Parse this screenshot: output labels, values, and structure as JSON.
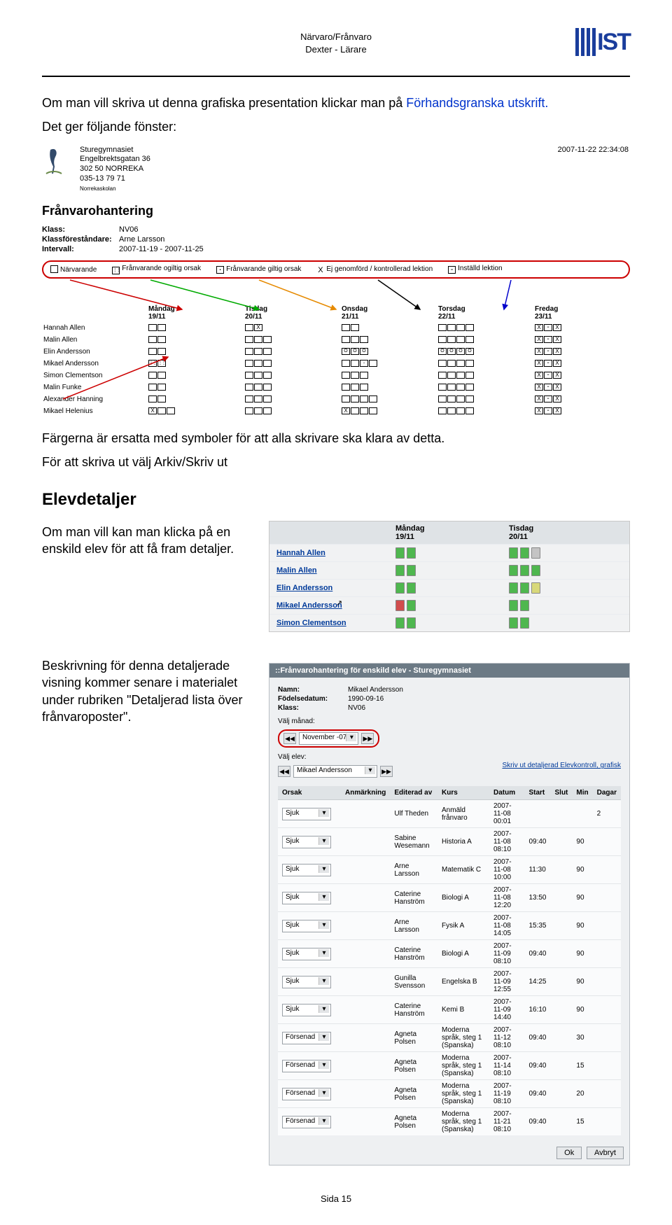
{
  "header": {
    "line1": "Närvaro/Frånvaro",
    "line2": "Dexter - Lärare",
    "logo_text": "IST"
  },
  "intro": {
    "p1a": "Om man vill skriva ut denna grafiska presentation klickar man på ",
    "p1_link": "Förhandsgranska utskrift.",
    "p2": "Det ger följande fönster:"
  },
  "ss1": {
    "school": [
      "Sturegymnasiet",
      "Engelbrektsgatan 36",
      "302 50 NORREKA",
      "",
      "035-13 79 71"
    ],
    "skolan": "Norrekaskolan",
    "timestamp": "2007-11-22 22:34:08",
    "title": "Frånvarohantering",
    "kv": [
      {
        "k": "Klass:",
        "v": "NV06"
      },
      {
        "k": "Klassföreståndare:",
        "v": "Arne Larsson"
      },
      {
        "k": "Intervall:",
        "v": "2007-11-19 - 2007-11-25"
      }
    ],
    "legend": [
      "Närvarande",
      "Frånvarande ogiltig orsak",
      "Frånvarande giltig orsak",
      "Ej genomförd / kontrollerad lektion",
      "Inställd lektion"
    ],
    "days": [
      {
        "d": "Måndag",
        "dd": "19/11"
      },
      {
        "d": "Tisdag",
        "dd": "20/11"
      },
      {
        "d": "Onsdag",
        "dd": "21/11"
      },
      {
        "d": "Torsdag",
        "dd": "22/11"
      },
      {
        "d": "Fredag",
        "dd": "23/11"
      }
    ],
    "rows": [
      {
        "n": "Hannah Allen",
        "c": [
          [
            "",
            ""
          ],
          [
            "",
            "x"
          ],
          [
            "",
            ""
          ],
          [
            "",
            "",
            "",
            ""
          ],
          [
            "x",
            "m",
            "x"
          ]
        ]
      },
      {
        "n": "Malin Allen",
        "c": [
          [
            "",
            ""
          ],
          [
            "",
            "",
            ""
          ],
          [
            "",
            "",
            ""
          ],
          [
            "",
            "",
            "",
            ""
          ],
          [
            "x",
            "m",
            "x"
          ]
        ]
      },
      {
        "n": "Elin Andersson",
        "c": [
          [
            "",
            ""
          ],
          [
            "",
            "",
            ""
          ],
          [
            "o",
            "o",
            "o"
          ],
          [
            "o",
            "o",
            "o",
            "o"
          ],
          [
            "x",
            "m",
            "x"
          ]
        ]
      },
      {
        "n": "Mikael Andersson",
        "c": [
          [
            "dots",
            "dots"
          ],
          [
            "",
            "",
            ""
          ],
          [
            "",
            "",
            "d",
            ""
          ],
          [
            "",
            "",
            "",
            ""
          ],
          [
            "x",
            "m",
            "x"
          ]
        ]
      },
      {
        "n": "Simon Clementson",
        "c": [
          [
            "",
            ""
          ],
          [
            "",
            "",
            ""
          ],
          [
            "",
            "",
            ""
          ],
          [
            "",
            "",
            "",
            ""
          ],
          [
            "x",
            "m",
            "x"
          ]
        ]
      },
      {
        "n": "Malin Funke",
        "c": [
          [
            "",
            ""
          ],
          [
            "",
            "",
            ""
          ],
          [
            "",
            "",
            ""
          ],
          [
            "",
            "",
            "",
            ""
          ],
          [
            "x",
            "m",
            "x"
          ]
        ]
      },
      {
        "n": "Alexander Hanning",
        "c": [
          [
            "",
            ""
          ],
          [
            "",
            "",
            ""
          ],
          [
            "",
            "",
            "",
            ""
          ],
          [
            "",
            "",
            "",
            ""
          ],
          [
            "x",
            "m",
            "x"
          ]
        ]
      },
      {
        "n": "Mikael Helenius",
        "c": [
          [
            "x",
            "",
            ""
          ],
          [
            "",
            "",
            ""
          ],
          [
            "x",
            "",
            "",
            ""
          ],
          [
            "",
            "",
            "",
            ""
          ],
          [
            "x",
            "m",
            "x"
          ]
        ]
      }
    ]
  },
  "after1": {
    "p1": "Färgerna är ersatta med symboler för att alla skrivare ska klara av detta.",
    "p2": "För att skriva ut välj Arkiv/Skriv ut"
  },
  "elevdetaljer": {
    "title": "Elevdetaljer",
    "p": "Om man vill kan man klicka på en enskild elev för att få fram detaljer."
  },
  "ss2": {
    "days": [
      {
        "d": "Måndag",
        "dd": "19/11"
      },
      {
        "d": "Tisdag",
        "dd": "20/11"
      }
    ],
    "rows": [
      {
        "n": "Hannah Allen",
        "c1": [
          "g",
          "g"
        ],
        "c2": [
          "g",
          "g",
          "gr"
        ]
      },
      {
        "n": "Malin Allen",
        "c1": [
          "g",
          "g"
        ],
        "c2": [
          "g",
          "g",
          "g"
        ]
      },
      {
        "n": "Elin Andersson",
        "c1": [
          "g",
          "g"
        ],
        "c2": [
          "g",
          "g",
          "y"
        ]
      },
      {
        "n": "Mikael Andersson",
        "c1": [
          "r",
          "g"
        ],
        "c2": [
          "g",
          "g"
        ]
      },
      {
        "n": "Simon Clementson",
        "c1": [
          "g",
          "g"
        ],
        "c2": [
          "g",
          "g"
        ]
      }
    ]
  },
  "detail_p": "Beskrivning för denna detaljerade visning kommer senare i materialet under rubriken \"Detaljerad lista över frånvaroposter\".",
  "ss3": {
    "bar": "::Frånvarohantering för enskild elev - Sturegymnasiet",
    "kv": [
      {
        "k": "Namn:",
        "v": "Mikael Andersson"
      },
      {
        "k": "Födelsedatum:",
        "v": "1990-09-16"
      },
      {
        "k": "Klass:",
        "v": "NV06"
      }
    ],
    "sel1_label": "Välj månad:",
    "sel1_value": "November -07",
    "sel2_label": "Välj elev:",
    "sel2_value": "Mikael Andersson",
    "link": "Skriv ut detaljerad Elevkontroll, grafisk",
    "th": [
      "Orsak",
      "Anmärkning",
      "Editerad av",
      "Kurs",
      "Datum",
      "Start",
      "Slut",
      "Min",
      "Dagar"
    ],
    "rows": [
      {
        "o": "Sjuk",
        "a": "",
        "e": "Ulf Theden",
        "k": "Anmäld frånvaro",
        "d": "2007-11-08 00:01",
        "s": "",
        "sl": "",
        "m": "",
        "dg": "2"
      },
      {
        "o": "Sjuk",
        "a": "",
        "e": "Sabine Wesemann",
        "k": "Historia A",
        "d": "2007-11-08 08:10",
        "s": "09:40",
        "sl": "",
        "m": "90",
        "dg": ""
      },
      {
        "o": "Sjuk",
        "a": "",
        "e": "Arne Larsson",
        "k": "Matematik C",
        "d": "2007-11-08 10:00",
        "s": "11:30",
        "sl": "",
        "m": "90",
        "dg": ""
      },
      {
        "o": "Sjuk",
        "a": "",
        "e": "Caterine Hanström",
        "k": "Biologi A",
        "d": "2007-11-08 12:20",
        "s": "13:50",
        "sl": "",
        "m": "90",
        "dg": ""
      },
      {
        "o": "Sjuk",
        "a": "",
        "e": "Arne Larsson",
        "k": "Fysik A",
        "d": "2007-11-08 14:05",
        "s": "15:35",
        "sl": "",
        "m": "90",
        "dg": ""
      },
      {
        "o": "Sjuk",
        "a": "",
        "e": "Caterine Hanström",
        "k": "Biologi A",
        "d": "2007-11-09 08:10",
        "s": "09:40",
        "sl": "",
        "m": "90",
        "dg": ""
      },
      {
        "o": "Sjuk",
        "a": "",
        "e": "Gunilla Svensson",
        "k": "Engelska B",
        "d": "2007-11-09 12:55",
        "s": "14:25",
        "sl": "",
        "m": "90",
        "dg": ""
      },
      {
        "o": "Sjuk",
        "a": "",
        "e": "Caterine Hanström",
        "k": "Kemi B",
        "d": "2007-11-09 14:40",
        "s": "16:10",
        "sl": "",
        "m": "90",
        "dg": ""
      },
      {
        "o": "Försenad",
        "a": "",
        "e": "Agneta Polsen",
        "k": "Moderna språk, steg 1 (Spanska)",
        "d": "2007-11-12 08:10",
        "s": "09:40",
        "sl": "",
        "m": "30",
        "dg": ""
      },
      {
        "o": "Försenad",
        "a": "",
        "e": "Agneta Polsen",
        "k": "Moderna språk, steg 1 (Spanska)",
        "d": "2007-11-14 08:10",
        "s": "09:40",
        "sl": "",
        "m": "15",
        "dg": ""
      },
      {
        "o": "Försenad",
        "a": "",
        "e": "Agneta Polsen",
        "k": "Moderna språk, steg 1 (Spanska)",
        "d": "2007-11-19 08:10",
        "s": "09:40",
        "sl": "",
        "m": "20",
        "dg": ""
      },
      {
        "o": "Försenad",
        "a": "",
        "e": "Agneta Polsen",
        "k": "Moderna språk, steg 1 (Spanska)",
        "d": "2007-11-21 08:10",
        "s": "09:40",
        "sl": "",
        "m": "15",
        "dg": ""
      }
    ],
    "btn_ok": "Ok",
    "btn_cancel": "Avbryt"
  },
  "footer": "Sida 15"
}
